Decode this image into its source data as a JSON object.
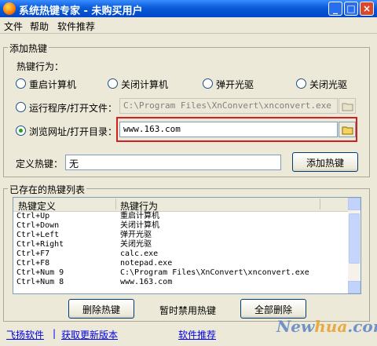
{
  "window": {
    "title": "系统热键专家 - 未购买用户"
  },
  "menu": [
    "文件",
    "帮助",
    "软件推荐"
  ],
  "add_group": {
    "title": "添加热键",
    "action_label": "热键行为：",
    "radios": [
      {
        "label": "重启计算机",
        "checked": false
      },
      {
        "label": "关闭计算机",
        "checked": false
      },
      {
        "label": "弹开光驱",
        "checked": false
      },
      {
        "label": "关闭光驱",
        "checked": false
      }
    ],
    "run_program": {
      "label": "运行程序/打开文件：",
      "value": "C:\\Program Files\\XnConvert\\xnconvert.exe",
      "checked": false
    },
    "browse_url": {
      "label": "浏览网址/打开目录：",
      "value": "www.163.com",
      "checked": true
    },
    "hotkey_label": "定义热键：",
    "hotkey_value": "无",
    "add_button": "添加热键"
  },
  "list_group": {
    "title": "已存在的热键列表",
    "columns": [
      "热键定义",
      "热键行为"
    ],
    "rows": [
      [
        "Ctrl+Up",
        "重启计算机"
      ],
      [
        "Ctrl+Down",
        "关闭计算机"
      ],
      [
        "Ctrl+Left",
        "弹开光驱"
      ],
      [
        "Ctrl+Right",
        "关闭光驱"
      ],
      [
        "Ctrl+F7",
        "calc.exe"
      ],
      [
        "Ctrl+F8",
        "notepad.exe"
      ],
      [
        "Ctrl+Num 9",
        "C:\\Program Files\\XnConvert\\xnconvert.exe"
      ],
      [
        "Ctrl+Num 8",
        "www.163.com"
      ]
    ],
    "buttons": {
      "delete": "删除热键",
      "disable": "暂时禁用热键",
      "delete_all": "全部删除"
    }
  },
  "footer": {
    "left_link": "飞扬软件",
    "separator": "|",
    "update_link": "获取更新版本",
    "recommend_link": "软件推荐",
    "watermark_a": "New",
    "watermark_b": "hua",
    "watermark_c": ".com"
  },
  "colors": {
    "titlebar": "#0a5bd8",
    "highlight_box": "#d12020",
    "face": "#ece9d8"
  }
}
